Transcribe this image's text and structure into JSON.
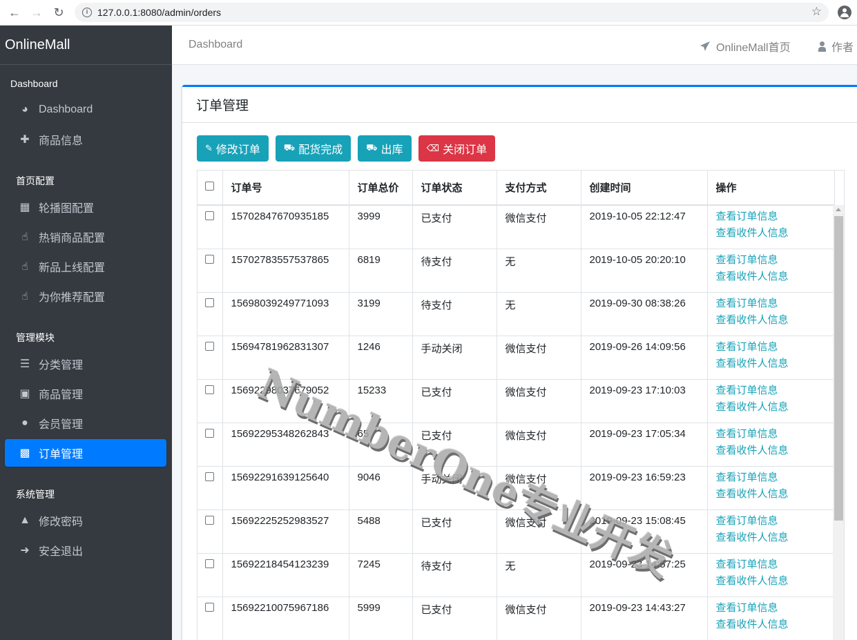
{
  "browser": {
    "url": "127.0.0.1:8080/admin/orders"
  },
  "sidebar": {
    "brand": "OnlineMall",
    "sections": [
      {
        "header": "Dashboard",
        "items": [
          {
            "label": "Dashboard",
            "icon": "dashboard-icon"
          },
          {
            "label": "商品信息",
            "icon": "plus-icon"
          }
        ]
      },
      {
        "header": "首页配置",
        "items": [
          {
            "label": "轮播图配置",
            "icon": "image-icon"
          },
          {
            "label": "热销商品配置",
            "icon": "hand-pointer-icon"
          },
          {
            "label": "新品上线配置",
            "icon": "hand-pointer-icon"
          },
          {
            "label": "为你推荐配置",
            "icon": "hand-pointer-icon"
          }
        ]
      },
      {
        "header": "管理模块",
        "items": [
          {
            "label": "分类管理",
            "icon": "list-icon"
          },
          {
            "label": "商品管理",
            "icon": "archive-icon"
          },
          {
            "label": "会员管理",
            "icon": "users-icon"
          },
          {
            "label": "订单管理",
            "icon": "money-bill-icon",
            "active": true
          }
        ]
      },
      {
        "header": "系统管理",
        "items": [
          {
            "label": "修改密码",
            "icon": "user-secret-icon"
          },
          {
            "label": "安全退出",
            "icon": "sign-out-icon"
          }
        ]
      }
    ]
  },
  "topbar": {
    "breadcrumb": "Dashboard",
    "home_link": "OnlineMall首页",
    "author_link": "作者"
  },
  "card": {
    "title": "订单管理",
    "buttons": [
      {
        "label": "修改订单",
        "icon": "edit-icon",
        "color": "#17a2b8"
      },
      {
        "label": "配货完成",
        "icon": "truck-icon",
        "color": "#17a2b8"
      },
      {
        "label": "出库",
        "icon": "truck-icon",
        "color": "#17a2b8"
      },
      {
        "label": "关闭订单",
        "icon": "trash-icon",
        "color": "#dc3545"
      }
    ]
  },
  "table": {
    "columns": [
      "订单号",
      "订单总价",
      "订单状态",
      "支付方式",
      "创建时间",
      "操作"
    ],
    "rows": [
      {
        "order_no": "15702847670935185",
        "total": "3999",
        "status": "已支付",
        "pay": "微信支付",
        "created": "2019-10-05 22:12:47"
      },
      {
        "order_no": "15702783557537865",
        "total": "6819",
        "status": "待支付",
        "pay": "无",
        "created": "2019-10-05 20:20:10"
      },
      {
        "order_no": "15698039249771093",
        "total": "3199",
        "status": "待支付",
        "pay": "无",
        "created": "2019-09-30 08:38:26"
      },
      {
        "order_no": "15694781962831307",
        "total": "1246",
        "status": "手动关闭",
        "pay": "微信支付",
        "created": "2019-09-26 14:09:56"
      },
      {
        "order_no": "15692298037679052",
        "total": "15233",
        "status": "已支付",
        "pay": "微信支付",
        "created": "2019-09-23 17:10:03"
      },
      {
        "order_no": "15692295348262843",
        "total": "65",
        "status": "已支付",
        "pay": "微信支付",
        "created": "2019-09-23 17:05:34"
      },
      {
        "order_no": "15692291639125640",
        "total": "9046",
        "status": "手动关闭",
        "pay": "微信支付",
        "created": "2019-09-23 16:59:23"
      },
      {
        "order_no": "15692225252983527",
        "total": "5488",
        "status": "已支付",
        "pay": "微信支付",
        "created": "2019-09-23 15:08:45"
      },
      {
        "order_no": "15692218454123239",
        "total": "7245",
        "status": "待支付",
        "pay": "无",
        "created": "2019-09-23 14:57:25"
      },
      {
        "order_no": "15692210075967186",
        "total": "5999",
        "status": "已支付",
        "pay": "微信支付",
        "created": "2019-09-23 14:43:27"
      }
    ],
    "action_view_order": "查看订单信息",
    "action_view_receiver": "查看收件人信息"
  },
  "watermark": "NumberOne专业开发",
  "colors": {
    "primary": "#007bff",
    "info": "#17a2b8",
    "danger": "#dc3545",
    "sidebar_bg": "#343a40"
  }
}
